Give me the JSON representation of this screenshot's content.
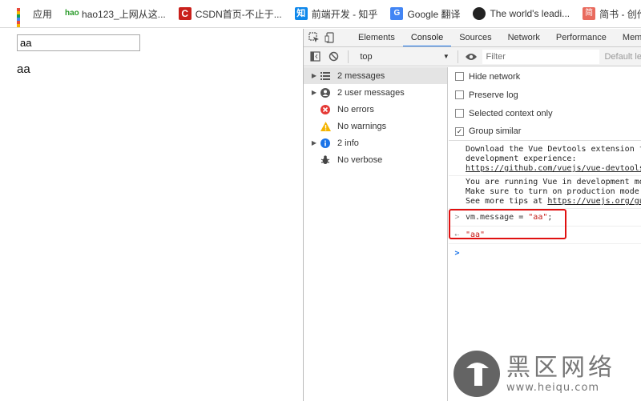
{
  "bookmarks": [
    {
      "label": "应用",
      "icon": "apps-grid-icon"
    },
    {
      "label": "hao123_上网从这...",
      "icon": "hao123-icon",
      "icon_text": "hao"
    },
    {
      "label": "CSDN首页-不止于...",
      "icon": "csdn-icon",
      "icon_text": "C"
    },
    {
      "label": "前端开发 - 知乎",
      "icon": "zhihu-icon",
      "icon_text": "知"
    },
    {
      "label": "Google 翻译",
      "icon": "google-translate-icon",
      "icon_text": "G"
    },
    {
      "label": "The world's leadi...",
      "icon": "github-icon"
    },
    {
      "label": "简书 - 创作你的",
      "icon": "jianshu-icon",
      "icon_text": "简"
    }
  ],
  "page": {
    "input_value": "aa",
    "output_text": "aa"
  },
  "devtools": {
    "tabs": [
      "Elements",
      "Console",
      "Sources",
      "Network",
      "Performance",
      "Memo"
    ],
    "active_tab": "Console",
    "context": "top",
    "filter_placeholder": "Filter",
    "default_levels": "Default le",
    "sidebar": [
      {
        "label": "2 messages",
        "icon": "list-icon",
        "expandable": true
      },
      {
        "label": "2 user messages",
        "icon": "user-icon",
        "expandable": true
      },
      {
        "label": "No errors",
        "icon": "error-icon",
        "expandable": false
      },
      {
        "label": "No warnings",
        "icon": "warning-icon",
        "expandable": false
      },
      {
        "label": "2 info",
        "icon": "info-icon",
        "expandable": true
      },
      {
        "label": "No verbose",
        "icon": "verbose-bug-icon",
        "expandable": false
      }
    ],
    "options": [
      {
        "label": "Hide network",
        "checked": false
      },
      {
        "label": "Preserve log",
        "checked": false
      },
      {
        "label": "Selected context only",
        "checked": false
      },
      {
        "label": "Group similar",
        "checked": true
      }
    ],
    "messages": [
      {
        "line1": "Download the Vue Devtools extension fo",
        "line2": "development experience:",
        "link": "https://github.com/vuejs/vue-devtools"
      },
      {
        "line1": "You are running Vue in development mod",
        "line2": "Make sure to turn on production mode w",
        "line3_prefix": "See more tips at ",
        "link": "https://vuejs.org/gui"
      }
    ],
    "command": {
      "code_prefix": "vm.message = ",
      "code_string": "\"aa\"",
      "code_suffix": ";"
    },
    "result": "\"aa\"",
    "prompt": ">"
  },
  "watermark": {
    "cn": "黑区网络",
    "url": "www.heiqu.com"
  },
  "colors": {
    "accent_tab": "#1a73e8",
    "highlight_box": "#e01010",
    "string": "#c41a16",
    "error": "#e53935",
    "warning": "#f4b400",
    "info": "#1a73e8"
  }
}
